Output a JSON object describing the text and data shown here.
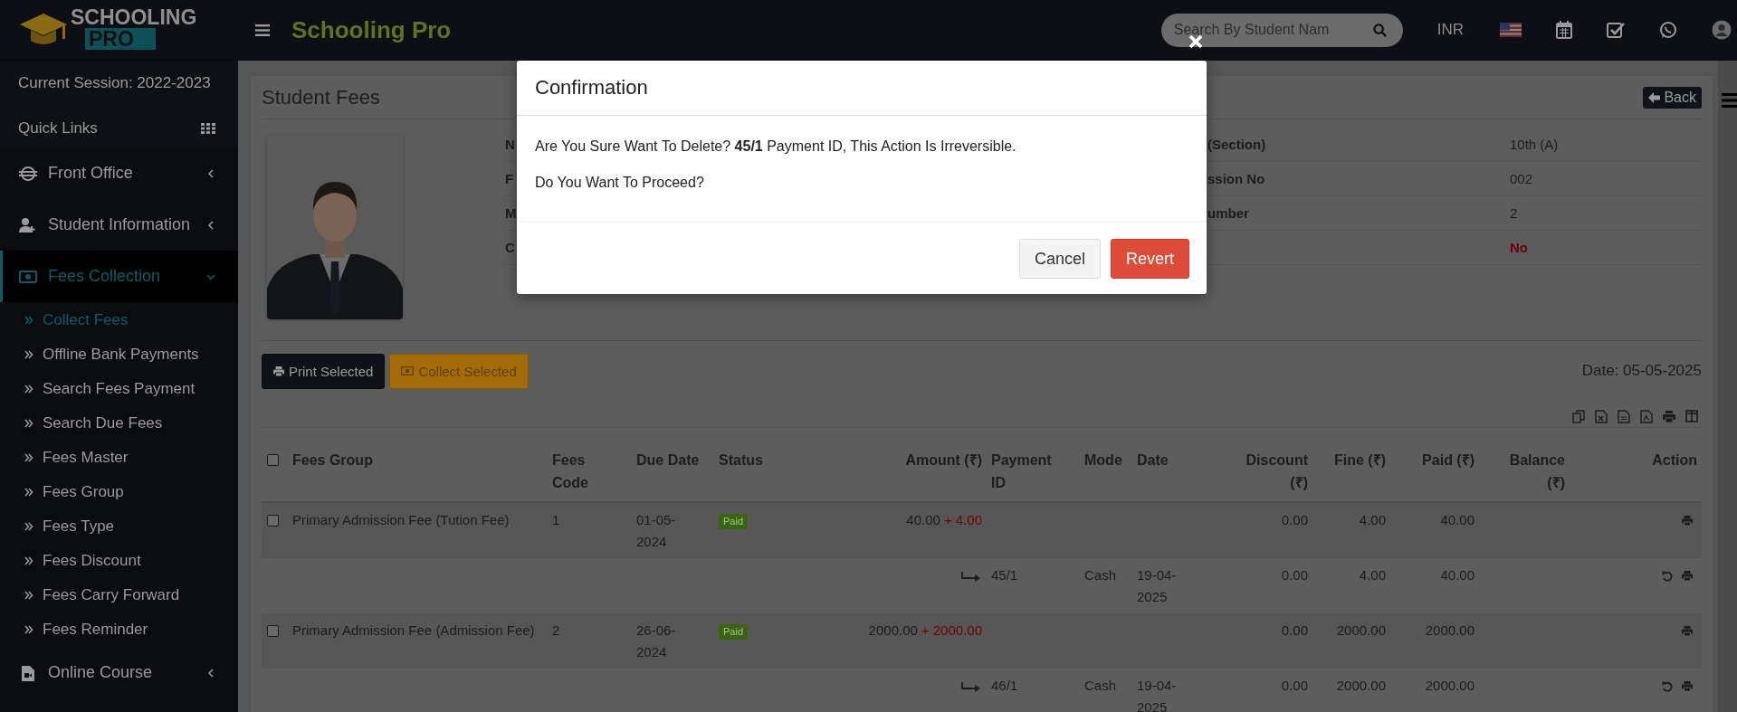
{
  "header": {
    "logo_top": "SCHOOLING",
    "logo_bottom": "PRO",
    "app_title": "Schooling Pro",
    "search": {
      "placeholder": "Search By Student Nam"
    },
    "currency": "INR"
  },
  "sidebar": {
    "session": "Current Session: 2022-2023",
    "quick_links": "Quick Links",
    "items": [
      {
        "label": "Front Office",
        "expanded": false,
        "selected": false
      },
      {
        "label": "Student Information",
        "expanded": false,
        "selected": false
      },
      {
        "label": "Fees Collection",
        "expanded": true,
        "selected": true,
        "children": [
          {
            "label": "Collect Fees",
            "selected": true
          },
          {
            "label": "Offline Bank Payments",
            "selected": false
          },
          {
            "label": "Search Fees Payment",
            "selected": false
          },
          {
            "label": "Search Due Fees",
            "selected": false
          },
          {
            "label": "Fees Master",
            "selected": false
          },
          {
            "label": "Fees Group",
            "selected": false
          },
          {
            "label": "Fees Type",
            "selected": false
          },
          {
            "label": "Fees Discount",
            "selected": false
          },
          {
            "label": "Fees Carry Forward",
            "selected": false
          },
          {
            "label": "Fees Reminder",
            "selected": false
          }
        ]
      },
      {
        "label": "Online Course",
        "expanded": false,
        "selected": false
      }
    ]
  },
  "page": {
    "title": "Student Fees",
    "back": "Back",
    "info_left": [
      {
        "label": "N"
      },
      {
        "label": "F"
      },
      {
        "label": "M"
      },
      {
        "label": "C"
      }
    ],
    "info_right": [
      {
        "label": "(Section)",
        "value": "10th (A)",
        "alert": false
      },
      {
        "label": "ssion No",
        "value": "002",
        "alert": false
      },
      {
        "label": "umber",
        "value": "2",
        "alert": false
      },
      {
        "value": "No",
        "alert": true
      }
    ],
    "print_selected": "Print Selected",
    "collect_selected": "Collect Selected",
    "date": "Date: 05-05-2025"
  },
  "table": {
    "select_all_checked": false,
    "columns": [
      {
        "kind": "checkbox"
      },
      {
        "label": "Fees Group"
      },
      {
        "label": "Fees Code"
      },
      {
        "label": "Due Date"
      },
      {
        "label": "Status"
      },
      {
        "label": "Amount (₹)"
      },
      {
        "label": "Payment ID"
      },
      {
        "label": "Mode"
      },
      {
        "label": "Date"
      },
      {
        "label": "Discount (₹)"
      },
      {
        "label": "Fine (₹)"
      },
      {
        "label": "Paid (₹)"
      },
      {
        "label": "Balance (₹)"
      },
      {
        "label": "Action"
      }
    ],
    "rows": [
      {
        "kind": "fee",
        "checked": false,
        "fees_group": "Primary Admission Fee (Tution Fee)",
        "fees_code": "1",
        "due_date": "01-05-2024",
        "status": "Paid",
        "amount": "40.00",
        "amount_fine": "+ 4.00",
        "discount": "0.00",
        "fine": "4.00",
        "paid": "40.00"
      },
      {
        "kind": "payment",
        "payment_id": "45/1",
        "mode": "Cash",
        "date": "19-04-2025",
        "discount": "0.00",
        "fine": "4.00",
        "paid": "40.00"
      },
      {
        "kind": "fee",
        "checked": false,
        "fees_group": "Primary Admission Fee (Admission Fee)",
        "fees_code": "2",
        "due_date": "26-06-2024",
        "status": "Paid",
        "amount": "2000.00",
        "amount_fine": "+ 2000.00",
        "discount": "0.00",
        "fine": "2000.00",
        "paid": "2000.00"
      },
      {
        "kind": "payment",
        "payment_id": "46/1",
        "mode": "Cash",
        "date": "19-04-2025",
        "discount": "0.00",
        "fine": "2000.00",
        "paid": "2000.00"
      }
    ]
  },
  "modal": {
    "title": "Confirmation",
    "message": "Are You Sure Want To Delete? **45/1** Payment ID, This Action Is Irreversible.",
    "question": "Do You Want To Proceed?",
    "cancel": "Cancel",
    "confirm": "Revert"
  }
}
